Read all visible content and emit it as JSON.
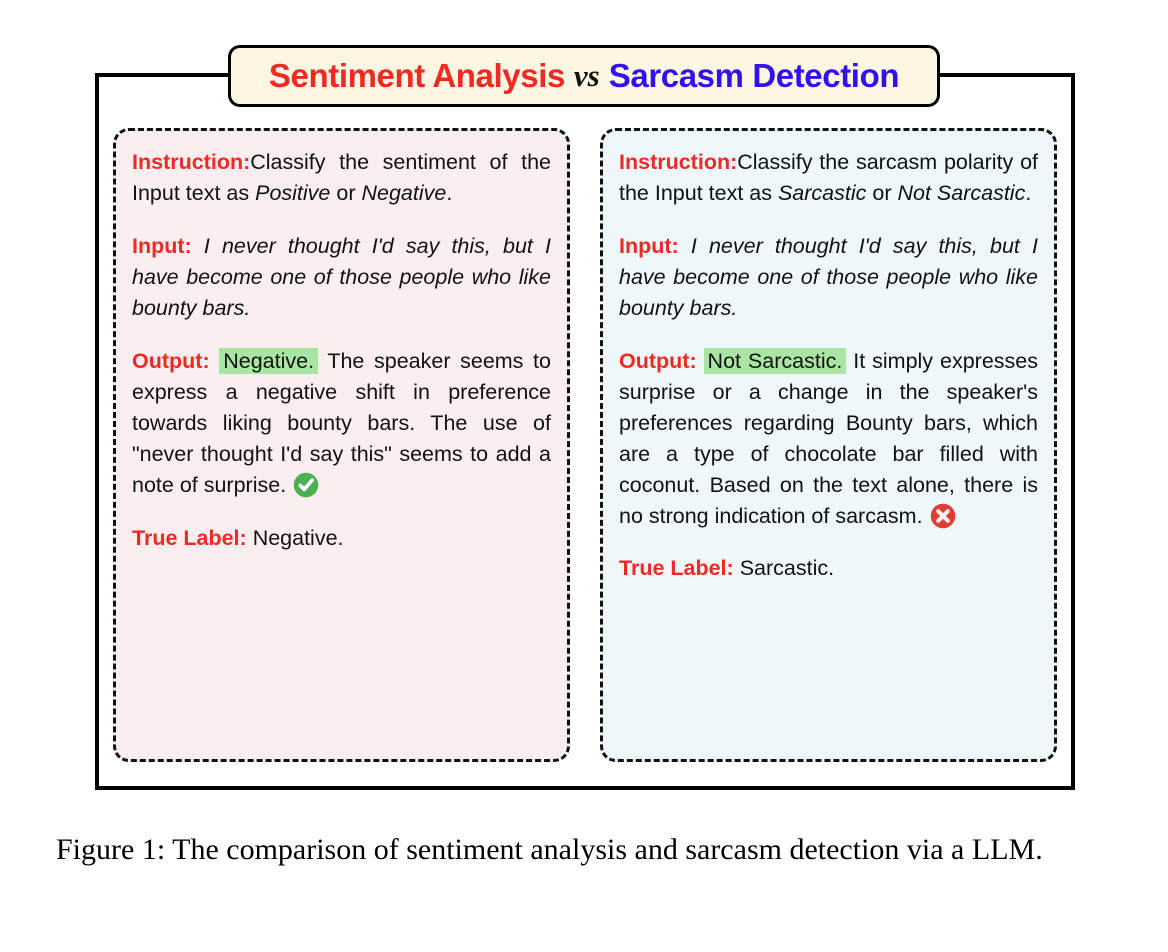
{
  "title": {
    "part_a": "Sentiment Analysis",
    "vs": "vs",
    "part_b": "Sarcasm Detection",
    "color_a": "#ee2a22",
    "color_vs": "#111111",
    "color_b": "#3311ee",
    "background": "#fdf6e3"
  },
  "panels": {
    "sentiment": {
      "background": "#fbeef0",
      "instruction_label": "Instruction:",
      "instruction_text_1": "Classify the sentiment of the Input text as ",
      "instruction_em_1": "Positive",
      "instruction_text_2": " or ",
      "instruction_em_2": "Negative",
      "instruction_text_3": ".",
      "input_label": "Input:",
      "input_text": "I never thought I'd say this, but I have become one of those people who like bounty bars.",
      "output_label": "Output:",
      "output_highlight": "Negative.",
      "output_text": "The speaker seems to express a negative shift in preference towards liking bounty bars. The use of \"never thought I'd say this\" seems to add a note of surprise.",
      "verdict_icon": "check-circle-icon",
      "verdict_color": "#4caf50",
      "true_label_label": "True Label:",
      "true_label_value": "Negative."
    },
    "sarcasm": {
      "background": "#eff7fb",
      "instruction_label": "Instruction:",
      "instruction_text_1": "Classify the sarcasm polarity of the Input text as ",
      "instruction_em_1": "Sarcastic",
      "instruction_text_2": " or ",
      "instruction_em_2": "Not Sarcastic",
      "instruction_text_3": ".",
      "input_label": "Input:",
      "input_text": "I never thought I'd say this, but I have become one of those people who like bounty bars.",
      "output_label": "Output:",
      "output_highlight": "Not Sarcastic.",
      "output_text": "It simply expresses surprise or a change in the speaker's preferences regarding Bounty bars, which are a type of chocolate bar filled with coconut. Based on the text alone, there is no strong indication of sarcasm.",
      "verdict_icon": "x-circle-icon",
      "verdict_color": "#e03c31",
      "true_label_label": "True Label:",
      "true_label_value": "Sarcastic."
    }
  },
  "highlight_color": "#a9e6a3",
  "label_color": "#ee2a22",
  "caption": "Figure 1: The comparison of sentiment analysis and sarcasm detection via a LLM."
}
